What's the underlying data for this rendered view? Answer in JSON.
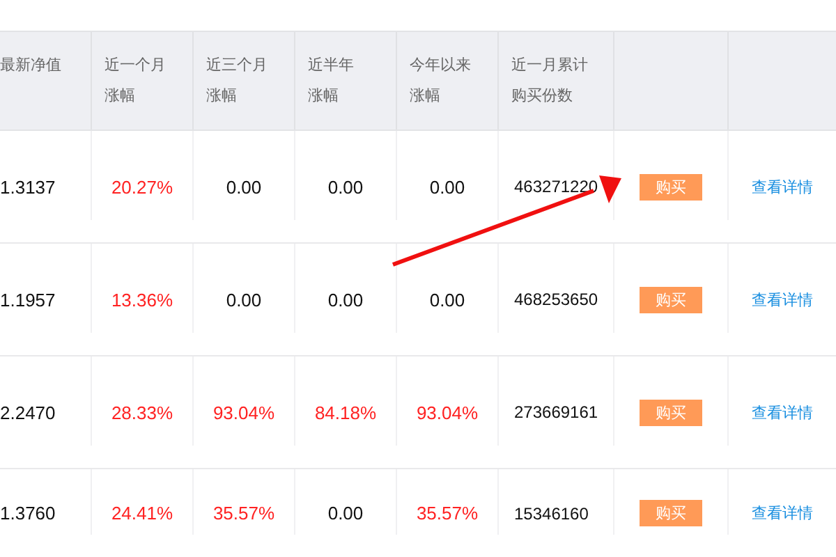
{
  "table": {
    "columns": [
      {
        "lines": [
          "最新净值"
        ]
      },
      {
        "lines": [
          "近一个月",
          "涨幅"
        ]
      },
      {
        "lines": [
          "近三个月",
          "涨幅"
        ]
      },
      {
        "lines": [
          "近半年",
          "涨幅"
        ]
      },
      {
        "lines": [
          "今年以来",
          "涨幅"
        ]
      },
      {
        "lines": [
          "近一月累计",
          "购买份数"
        ]
      }
    ],
    "rows": [
      {
        "nav": "1.3137",
        "changes": [
          {
            "text": "20.27%",
            "kind": "up"
          },
          {
            "text": "0.00",
            "kind": "flat"
          },
          {
            "text": "0.00",
            "kind": "flat"
          },
          {
            "text": "0.00",
            "kind": "flat"
          }
        ],
        "purchases": "463271220",
        "buy": "购买",
        "details": "查看详情"
      },
      {
        "nav": "1.1957",
        "changes": [
          {
            "text": "13.36%",
            "kind": "up"
          },
          {
            "text": "0.00",
            "kind": "flat"
          },
          {
            "text": "0.00",
            "kind": "flat"
          },
          {
            "text": "0.00",
            "kind": "flat"
          }
        ],
        "purchases": "468253650",
        "buy": "购买",
        "details": "查看详情"
      },
      {
        "nav": "2.2470",
        "changes": [
          {
            "text": "28.33%",
            "kind": "up"
          },
          {
            "text": "93.04%",
            "kind": "up"
          },
          {
            "text": "84.18%",
            "kind": "up"
          },
          {
            "text": "93.04%",
            "kind": "up"
          }
        ],
        "purchases": "273669161",
        "buy": "购买",
        "details": "查看详情"
      },
      {
        "nav": "1.3760",
        "changes": [
          {
            "text": "24.41%",
            "kind": "up"
          },
          {
            "text": "35.57%",
            "kind": "up"
          },
          {
            "text": "0.00",
            "kind": "flat"
          },
          {
            "text": "35.57%",
            "kind": "up"
          }
        ],
        "purchases": "15346160",
        "buy": "购买",
        "details": "查看详情"
      }
    ]
  },
  "annotation": {
    "kind": "arrow"
  }
}
